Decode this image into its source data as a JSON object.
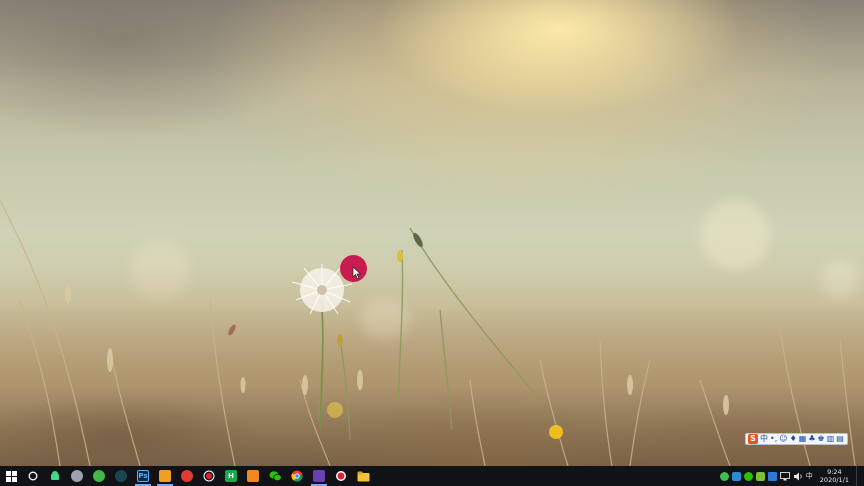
{
  "taskbar": {
    "apps": [
      {
        "id": "cortana",
        "icon": "cortana-circle-icon",
        "color": "#ffffff"
      },
      {
        "id": "app-green-android",
        "icon": "android-icon",
        "color": "#3ddc84"
      },
      {
        "id": "app-gray-round",
        "icon": "round-app-icon",
        "color": "#9aa3ad"
      },
      {
        "id": "app-green-leaf",
        "icon": "leaf-app-icon",
        "color": "#41b649"
      },
      {
        "id": "app-dark-teal",
        "icon": "teal-app-icon",
        "color": "#1f5d6b"
      },
      {
        "id": "photoshop",
        "icon": "photoshop-icon",
        "label": "Ps",
        "color": "#0e2a4a"
      },
      {
        "id": "app-orange-square",
        "icon": "orange-square-icon",
        "color": "#f0a020"
      },
      {
        "id": "app-red-bird",
        "icon": "red-bird-icon",
        "color": "#e03c31"
      },
      {
        "id": "app-red-record",
        "icon": "record-icon",
        "color": "#e81e2c"
      },
      {
        "id": "app-green-h",
        "icon": "h-app-icon",
        "label": "H",
        "color": "#19a84a"
      },
      {
        "id": "app-orange-box",
        "icon": "orange-box-icon",
        "color": "#f08a1c"
      },
      {
        "id": "wechat",
        "icon": "wechat-icon",
        "color": "#2dc100"
      },
      {
        "id": "chrome",
        "icon": "chrome-icon",
        "color": "#f4c20d"
      },
      {
        "id": "app-purple",
        "icon": "purple-app-icon",
        "color": "#6a3fb3"
      },
      {
        "id": "app-red-circle",
        "icon": "red-circle-icon",
        "color": "#d9232e"
      },
      {
        "id": "file-explorer",
        "icon": "folder-icon",
        "color": "#f3c13a"
      }
    ],
    "tray": {
      "ime_label": "中",
      "time": "9:24",
      "date": "2020/1/1"
    }
  },
  "ime_toolbar": {
    "logo": "S",
    "mode": "中",
    "punct": "•,",
    "items": [
      "☺",
      "♦",
      "▦",
      "♣",
      "♚",
      "▥",
      "▤"
    ]
  },
  "colors": {
    "taskbar_bg": "#101216",
    "cursor_highlight": "#c8134c"
  }
}
